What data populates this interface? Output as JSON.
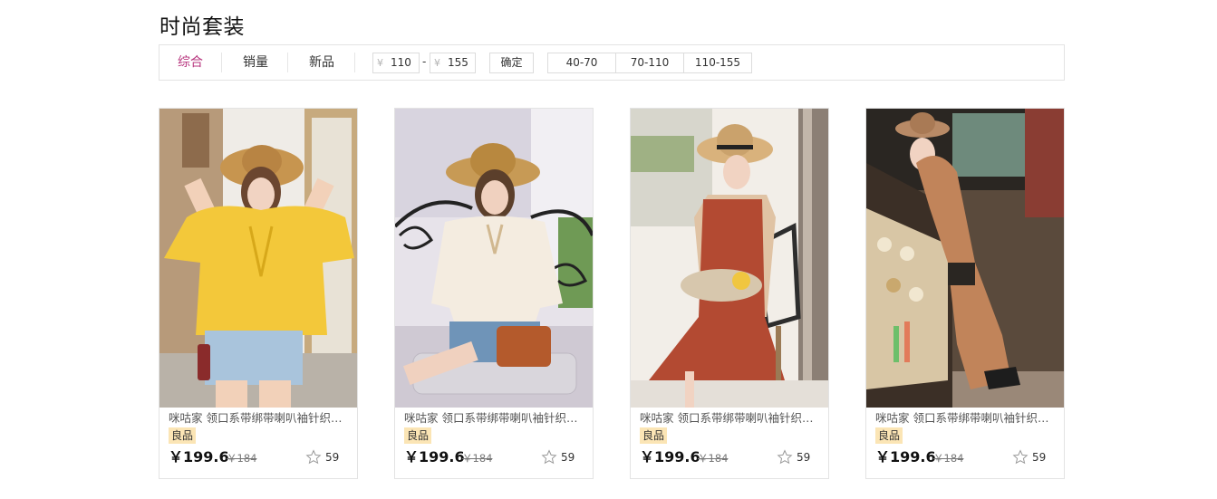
{
  "page": {
    "title": "时尚套装"
  },
  "filter": {
    "sort_tabs": [
      "综合",
      "销量",
      "新品"
    ],
    "currency_symbol": "¥",
    "price_min": "110",
    "price_max": "155",
    "range_separator": "-",
    "confirm_label": "确定",
    "ranges": [
      "40-70",
      "70-110",
      "110-155"
    ],
    "active_color": "#b7357e"
  },
  "products": [
    {
      "name": "咪咕家 领口系带绑带喇叭袖针织罩衫",
      "badge": "良品",
      "price": "￥199.6",
      "old_price": "￥184",
      "likes": "59"
    },
    {
      "name": "咪咕家 领口系带绑带喇叭袖针织罩衫",
      "badge": "良品",
      "price": "￥199.6",
      "old_price": "￥184",
      "likes": "59"
    },
    {
      "name": "咪咕家 领口系带绑带喇叭袖针织罩衫",
      "badge": "良品",
      "price": "￥199.6",
      "old_price": "￥184",
      "likes": "59"
    },
    {
      "name": "咪咕家 领口系带绑带喇叭袖针织罩衫",
      "badge": "良品",
      "price": "￥199.6",
      "old_price": "￥184",
      "likes": "59"
    }
  ]
}
